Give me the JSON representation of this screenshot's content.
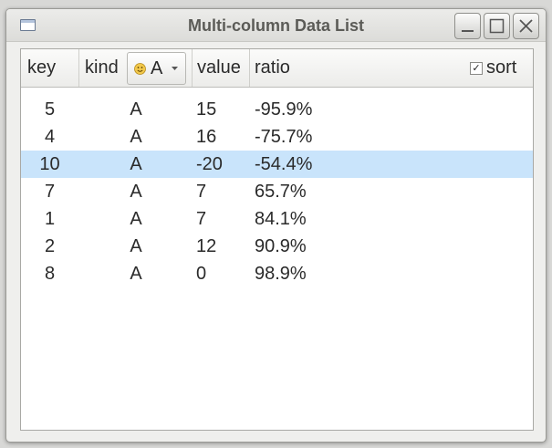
{
  "window": {
    "title": "Multi-column Data List"
  },
  "columns": {
    "key": "key",
    "kind": "kind",
    "value": "value",
    "ratio": "ratio"
  },
  "kind_filter": {
    "selected": "A",
    "icon": "smiley-icon"
  },
  "sort": {
    "label": "sort",
    "checked": true,
    "check_mark": "✓"
  },
  "rows": [
    {
      "key": "5",
      "kind": "A",
      "value": "15",
      "ratio": "-95.9%"
    },
    {
      "key": "4",
      "kind": "A",
      "value": "16",
      "ratio": "-75.7%"
    },
    {
      "key": "10",
      "kind": "A",
      "value": "-20",
      "ratio": "-54.4%"
    },
    {
      "key": "7",
      "kind": "A",
      "value": "7",
      "ratio": "65.7%"
    },
    {
      "key": "1",
      "kind": "A",
      "value": "7",
      "ratio": "84.1%"
    },
    {
      "key": "2",
      "kind": "A",
      "value": "12",
      "ratio": "90.9%"
    },
    {
      "key": "8",
      "kind": "A",
      "value": "0",
      "ratio": "98.9%"
    }
  ],
  "selected_row": 2,
  "colors": {
    "selection": "#c9e4fb",
    "title_text": "#5b5b57"
  }
}
